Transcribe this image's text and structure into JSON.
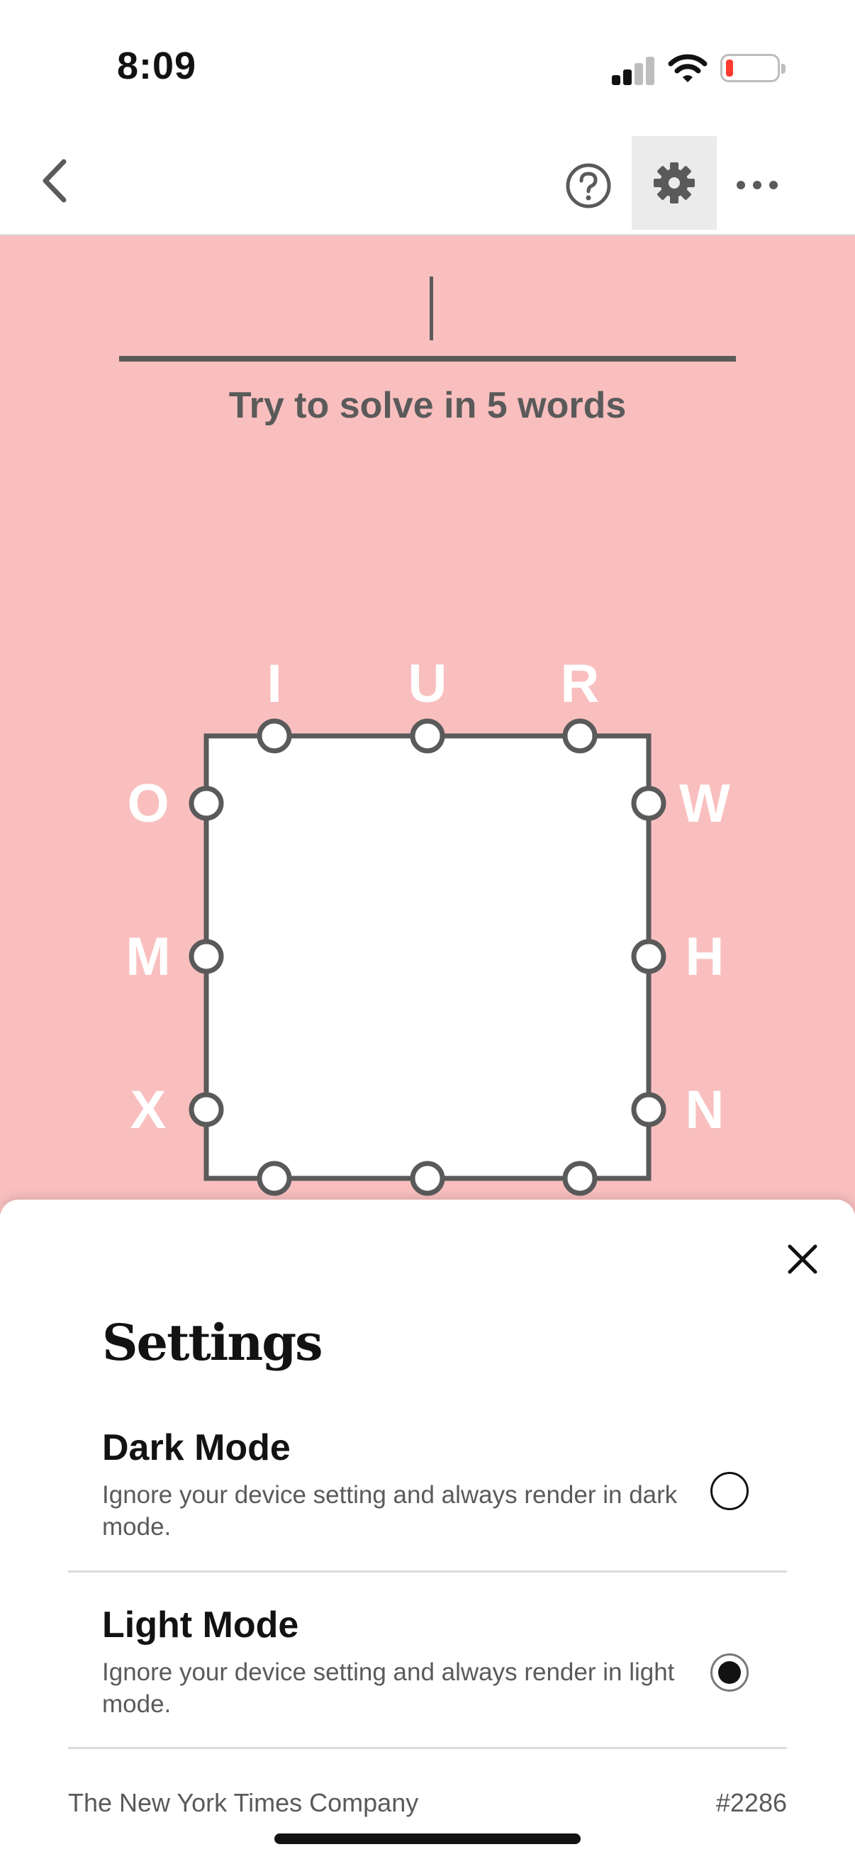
{
  "status_bar": {
    "time": "8:09",
    "signal_icon": "cellular-signal-icon",
    "wifi_icon": "wifi-icon",
    "battery_icon": "battery-low-icon",
    "battery_color": "#ff3b30"
  },
  "nav": {
    "back_icon": "chevron-left-icon",
    "help_icon": "question-circle-icon",
    "settings_icon": "gear-icon",
    "more_icon": "ellipsis-icon"
  },
  "game": {
    "background": "#f9bfbf",
    "input_value": "",
    "hint": "Try to solve in 5 words",
    "letters": {
      "top": [
        "I",
        "U",
        "R"
      ],
      "left": [
        "O",
        "M",
        "X"
      ],
      "right": [
        "W",
        "H",
        "N"
      ]
    }
  },
  "settings": {
    "title": "Settings",
    "close_icon": "close-icon",
    "options": [
      {
        "title": "Dark Mode",
        "description": "Ignore your device setting and always render in dark mode.",
        "selected": false
      },
      {
        "title": "Light Mode",
        "description": "Ignore your device setting and always render in light mode.",
        "selected": true
      }
    ],
    "footer_company": "The New York Times Company",
    "footer_number": "#2286"
  }
}
